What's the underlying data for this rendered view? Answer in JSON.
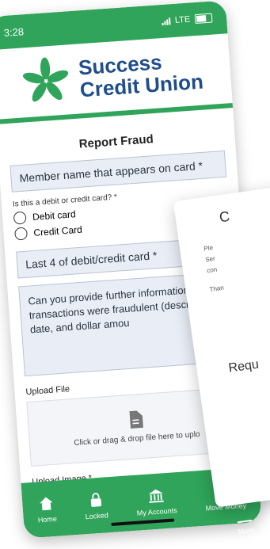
{
  "status_bar": {
    "time": "3:28",
    "network": "LTE"
  },
  "brand": {
    "line1": "Success",
    "line2": "Credit Union"
  },
  "page": {
    "title": "Report Fraud"
  },
  "form": {
    "member_name_placeholder": "Member name that appears on card *",
    "card_type_label": "Is this a debit or credit card? *",
    "card_type_options": [
      "Debit card",
      "Credit Card"
    ],
    "last4_placeholder": "Last 4 of debit/credit card *",
    "description_placeholder": "Can you provide further information which transactions were fraudulent (description, date, and dollar amou",
    "upload_file_label": "Upload File",
    "upload_file_hint": "Click or drag & drop file here to uplo",
    "upload_image_label": "Upload Image *"
  },
  "overlay": {
    "heading": "C",
    "lines": [
      "Ple",
      "Ser",
      "con",
      "Than"
    ],
    "bottom_text": "Requ"
  },
  "tabbar": {
    "items": [
      {
        "label": "Home",
        "icon": "home-icon"
      },
      {
        "label": "Locked",
        "icon": "lock-icon"
      },
      {
        "label": "My Accounts",
        "icon": "bank-icon"
      },
      {
        "label": "Move Money",
        "icon": "send-icon"
      },
      {
        "label": "More",
        "icon": "menu-icon"
      }
    ]
  },
  "colors": {
    "brand_green": "#2fa45a",
    "brand_blue": "#1f4e8c",
    "field_bg": "#e9eef6"
  }
}
